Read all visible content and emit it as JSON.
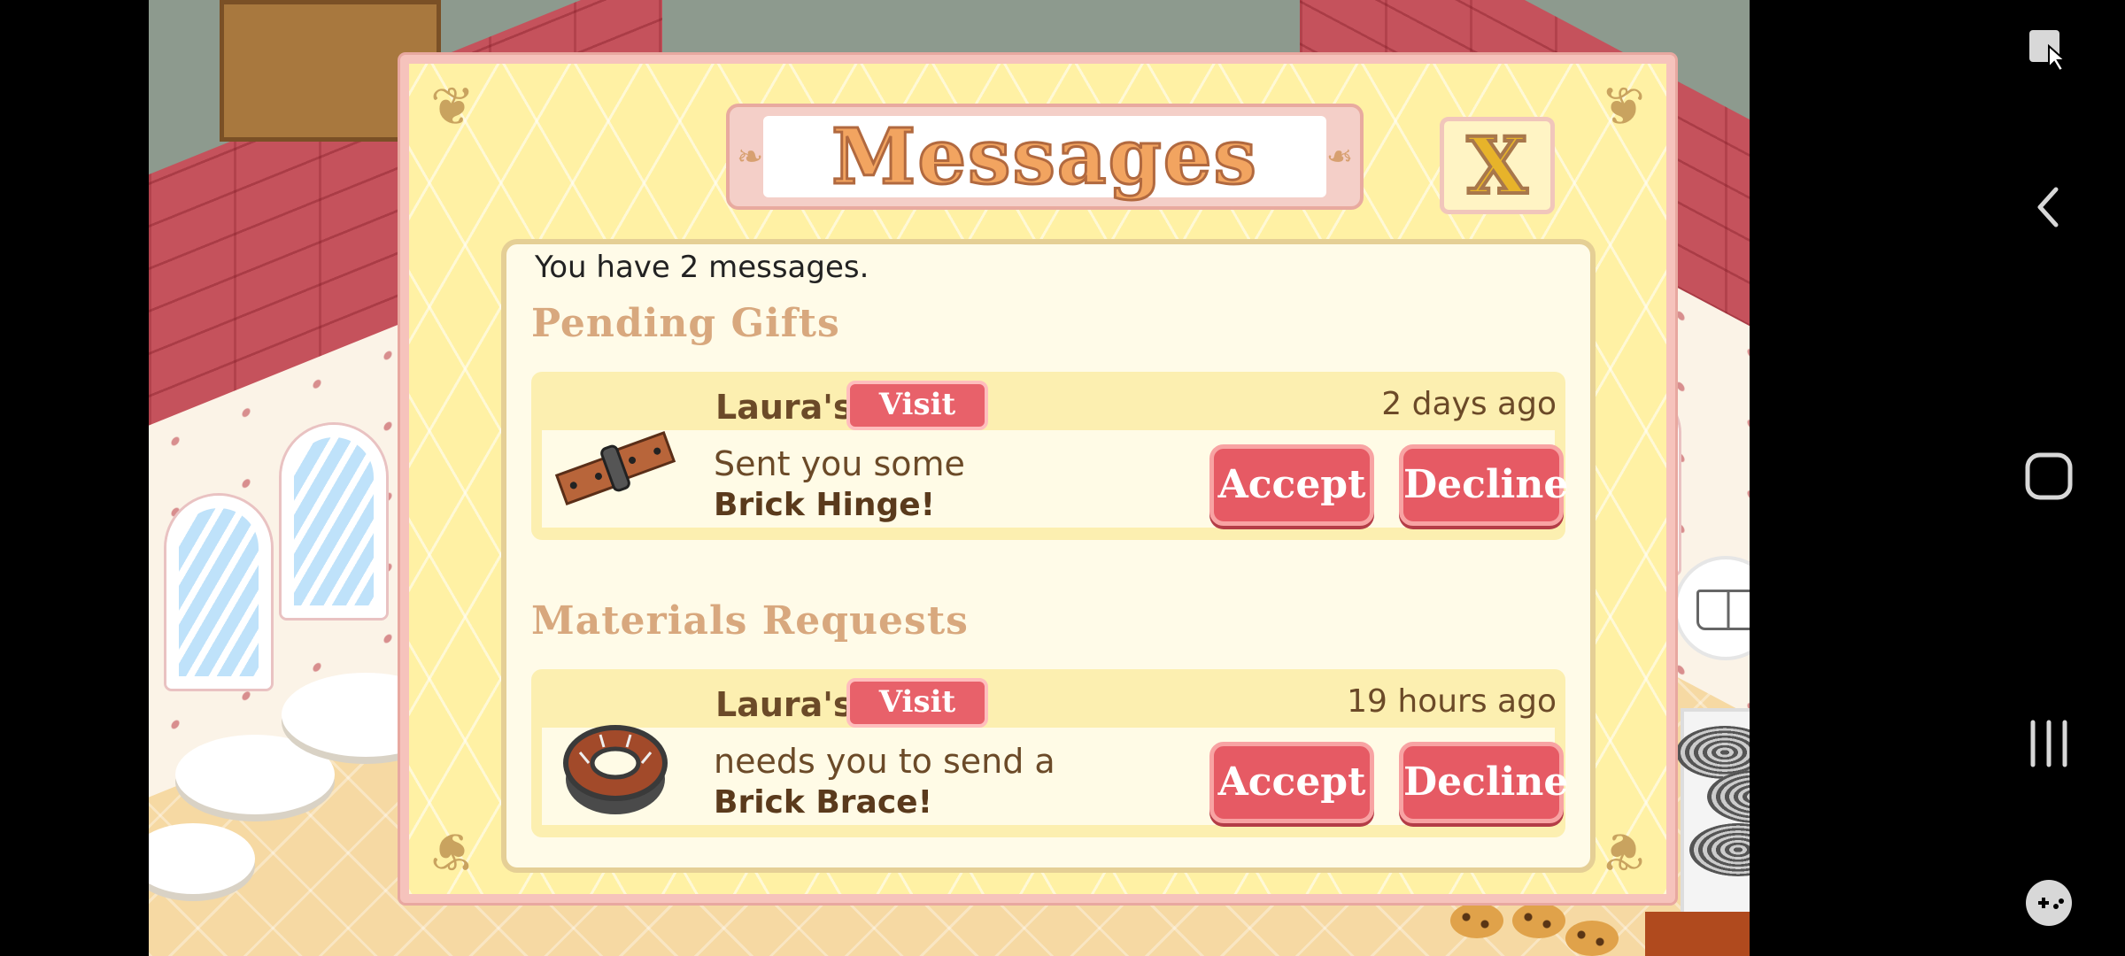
{
  "dialog": {
    "title": "Messages",
    "close_label": "X",
    "message_count_text": "You have 2 messages."
  },
  "sections": [
    {
      "title": "Pending Gifts",
      "message": {
        "sender": "Laura's",
        "visit_label": "Visit",
        "time": "2 days ago",
        "line1": "Sent you some",
        "item": "Brick Hinge!",
        "icon": "brick-hinge-icon",
        "accept_label": "Accept",
        "decline_label": "Decline"
      }
    },
    {
      "title": "Materials Requests",
      "message": {
        "sender": "Laura's",
        "visit_label": "Visit",
        "time": "19 hours ago",
        "line1": "needs you to send a",
        "item": "Brick Brace!",
        "icon": "brick-brace-icon",
        "accept_label": "Accept",
        "decline_label": "Decline"
      }
    }
  ],
  "navbar": {
    "icons": [
      "screen-pin-icon",
      "back-icon",
      "home-icon",
      "recents-icon",
      "game-controller-icon"
    ]
  },
  "colors": {
    "dialog_bg": "#fff1a4",
    "dialog_border": "#f6c3bc",
    "button_red": "#e65a64",
    "title_orange": "#f2a460",
    "text_brown": "#6b4a28"
  }
}
